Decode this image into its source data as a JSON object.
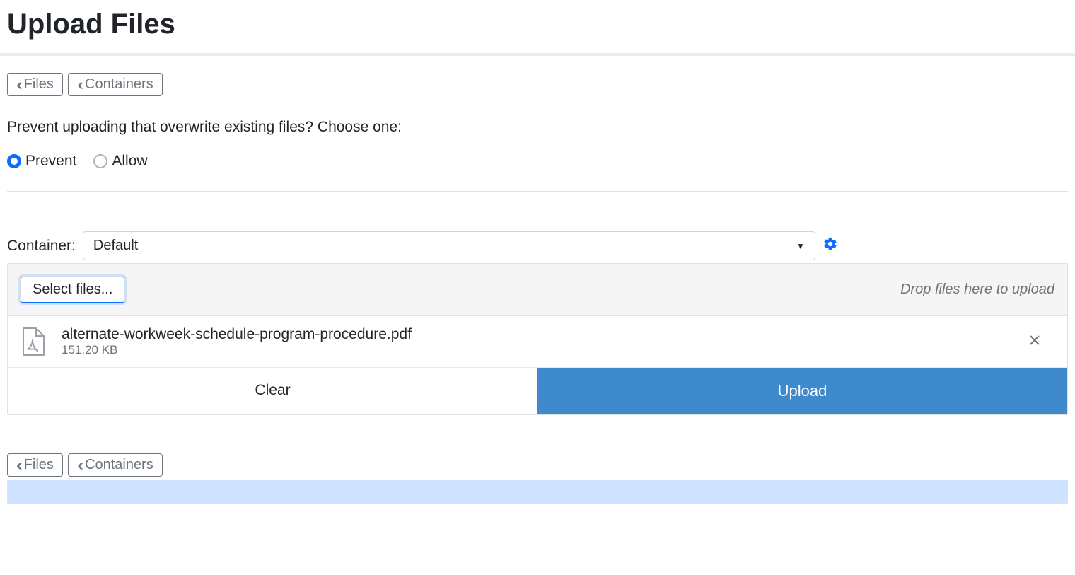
{
  "page": {
    "title": "Upload Files"
  },
  "nav": {
    "files": "Files",
    "containers": "Containers"
  },
  "overwrite": {
    "question": "Prevent uploading that overwrite existing files? Choose one:",
    "prevent": "Prevent",
    "allow": "Allow",
    "selected": "prevent"
  },
  "container": {
    "label": "Container:",
    "selected": "Default"
  },
  "uploader": {
    "select_button": "Select files...",
    "drop_hint": "Drop files here to upload",
    "clear": "Clear",
    "upload": "Upload",
    "files": [
      {
        "name": "alternate-workweek-schedule-program-procedure.pdf",
        "size": "151.20 KB"
      }
    ]
  }
}
